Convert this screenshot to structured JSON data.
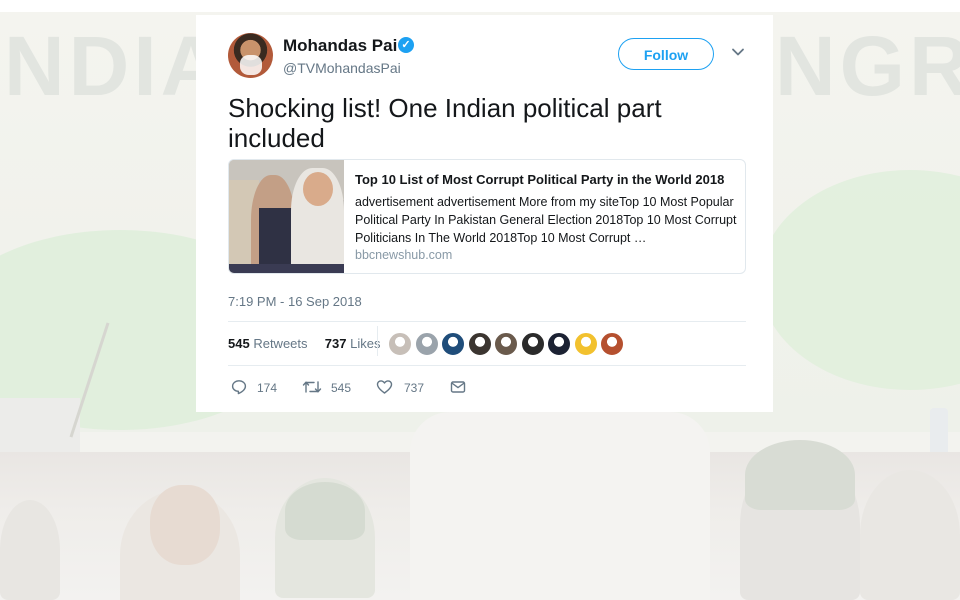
{
  "background": {
    "left_word": "NDIAN",
    "right_word": "NGRE"
  },
  "tweet": {
    "author_name": "Mohandas Pai",
    "author_handle": "@TVMohandasPai",
    "verified": true,
    "follow_label": "Follow",
    "text": "Shocking list! One Indian political part included",
    "card": {
      "title": "Top 10 List of Most Corrupt Political Party in the World 2018",
      "description": "advertisement advertisement More from my siteTop 10 Most Popular Political Party In Pakistan General Election 2018Top 10 Most Corrupt Politicians In The World 2018Top 10 Most Corrupt …",
      "domain": "bbcnewshub.com"
    },
    "timestamp": "7:19 PM - 16 Sep 2018",
    "stats": {
      "retweets_count": "545",
      "retweets_label": "Retweets",
      "likes_count": "737",
      "likes_label": "Likes"
    },
    "likers": [
      "#c7bfb8",
      "#9aa3ab",
      "#1f4d7a",
      "#3b3530",
      "#6a5a4c",
      "#2b2b2b",
      "#1c2233",
      "#f2c12e",
      "#b5502f"
    ],
    "actions": {
      "replies": "174",
      "retweets": "545",
      "likes": "737"
    },
    "colors": {
      "accent": "#1da1f2",
      "text": "#14171a",
      "muted": "#657786"
    }
  }
}
